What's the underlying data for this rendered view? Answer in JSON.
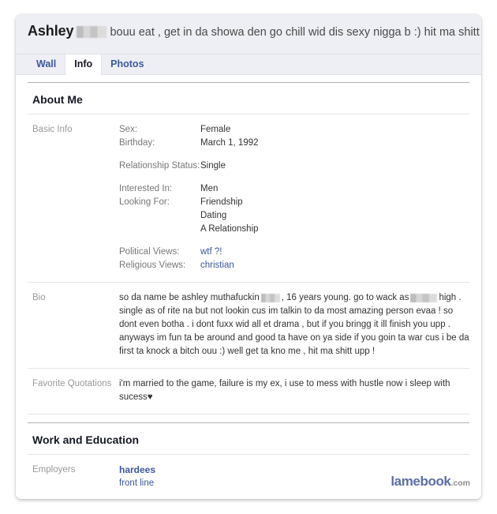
{
  "profile": {
    "name": "Ashley",
    "status_text": "bouu eat , get in da showa den go chill wid dis sexy nigga b :) hit ma shitt uppp !",
    "redacted_surname": "redacted-block"
  },
  "tabs": [
    {
      "label": "Wall",
      "active": false
    },
    {
      "label": "Info",
      "active": true
    },
    {
      "label": "Photos",
      "active": false
    }
  ],
  "sections": {
    "about": {
      "title": "About Me",
      "basic_info": {
        "label": "Basic Info",
        "groups": [
          {
            "pairs": [
              {
                "key": "Sex:",
                "value": "Female",
                "link": false
              },
              {
                "key": "Birthday:",
                "value": "March 1, 1992",
                "link": false
              }
            ]
          },
          {
            "pairs": [
              {
                "key": "Relationship Status:",
                "value": "Single",
                "link": false
              }
            ]
          },
          {
            "pairs": [
              {
                "key": "Interested In:",
                "value": "Men",
                "link": false
              },
              {
                "key": "Looking For:",
                "value": "Friendship",
                "link": false
              },
              {
                "key": "",
                "value": "Dating",
                "link": false
              },
              {
                "key": "",
                "value": "A Relationship",
                "link": false
              }
            ]
          },
          {
            "pairs": [
              {
                "key": "Political Views:",
                "value": "wtf ?!",
                "link": true
              },
              {
                "key": "Religious Views:",
                "value": "christian",
                "link": true
              }
            ]
          }
        ]
      },
      "bio": {
        "label": "Bio",
        "part1": "so da name be ashley muthafuckin",
        "part2": ", 16 years young. go to wack as",
        "part3": "high . single as of rite na but not lookin cus im talkin to da most amazing person evaa ! so dont even botha . i dont fuxx wid all et drama , but if you bringg it ill finish you upp . anyways im fun ta be around and good ta have on ya side if you goin ta war cus i be da first ta knock a bitch ouu :) well get ta kno me , hit ma shitt upp !"
      },
      "quotations": {
        "label": "Favorite Quotations",
        "text": "i'm married to the game, failure is my ex, i use to mess with hustle now i sleep with sucess♥"
      }
    },
    "work": {
      "title": "Work and Education",
      "employers": {
        "label": "Employers",
        "company": "hardees",
        "position": "front line"
      }
    }
  },
  "watermark": {
    "brand": "lamebook",
    "tld": ".com"
  }
}
